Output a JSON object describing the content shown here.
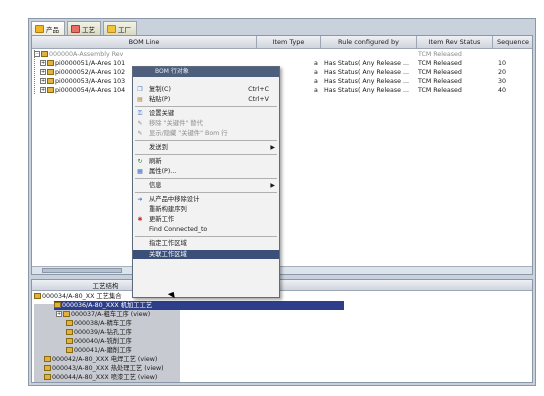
{
  "tabs": [
    "产品",
    "工艺",
    "工厂"
  ],
  "bom": {
    "columns": [
      "BOM Line",
      "Item Type",
      "Rule configured by",
      "Item Rev Status",
      "Sequence"
    ],
    "root": "000000A-Assembly Rev",
    "rows": [
      {
        "line": "pi0000051/A-Ares 101",
        "type": "a",
        "rule": "Has Status( Any Release ...",
        "status": "TCM Released",
        "seq": "10"
      },
      {
        "line": "pi0000052/A-Ares 102",
        "type": "a",
        "rule": "Has Status( Any Release ...",
        "status": "TCM Released",
        "seq": "20"
      },
      {
        "line": "pi0000053/A-Ares 103",
        "type": "a",
        "rule": "Has Status( Any Release ...",
        "status": "TCM Released",
        "seq": "30"
      },
      {
        "line": "pi0000054/A-Ares 104",
        "type": "a",
        "rule": "Has Status( Any Release ...",
        "status": "TCM Released",
        "seq": "40"
      }
    ],
    "root_status": "TCM Released"
  },
  "menu": {
    "title": "BOM 行对象",
    "items": [
      {
        "label": "复制(C)",
        "shortcut": "Ctrl+C"
      },
      {
        "label": "粘贴(P)",
        "shortcut": "Ctrl+V"
      },
      {
        "label": "设置关键"
      },
      {
        "label": "移除 \"关键件\" 替代"
      },
      {
        "label": "显示/隐藏 \"关键件\" Bom 行"
      },
      {
        "label": "发送到"
      },
      {
        "label": "刷新"
      },
      {
        "label": "属性(P)..."
      },
      {
        "label": "信息"
      },
      {
        "label": "从产品中移除设计"
      },
      {
        "label": "重新构建序列"
      },
      {
        "label": "更新工作"
      },
      {
        "label": "Find Connected_to"
      },
      {
        "label": "指定工作区域"
      },
      {
        "label": "关联工作区域"
      }
    ]
  },
  "workitems": {
    "columns": [
      "工艺结构",
      "Item Description"
    ],
    "rows": [
      "000034/A-80_XX 工艺集合",
      "000036/A-80_XXX 机加工工艺",
      "000037/A-粗车工序 (view)",
      "000038/A-精车工序",
      "000039/A-钻孔工序",
      "000040/A-铣削工序",
      "000041/A-磨削工序",
      "000042/A-80_XXX 电焊工艺 (view)",
      "000043/A-80_XXX 热处理工艺 (view)",
      "000044/A-80_XXX 喷漆工艺 (view)"
    ]
  }
}
